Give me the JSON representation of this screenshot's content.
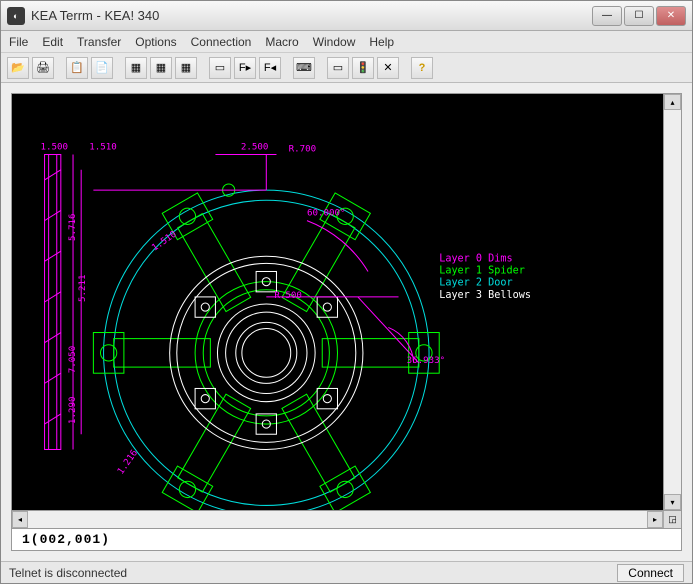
{
  "window": {
    "title": "KEA Terrm - KEA! 340"
  },
  "menu": {
    "file": "File",
    "edit": "Edit",
    "transfer": "Transfer",
    "options": "Options",
    "connection": "Connection",
    "macro": "Macro",
    "window": "Window",
    "help": "Help"
  },
  "toolbar": {
    "open": "📂",
    "print": "🖨",
    "copy": "📋",
    "paste": "📄",
    "t1": "▦",
    "t2": "▦",
    "t3": "▦",
    "t4": "▭",
    "t5": "F▸",
    "t6": "F◂",
    "t7": "⌨",
    "t8": "▭",
    "t9": "🚦",
    "t10": "✕",
    "help": "?"
  },
  "legend": {
    "l0_label": "Layer 0 Dims",
    "l1_label": "Layer 1 Spider",
    "l2_label": "Layer 2 Door",
    "l3_label": "Layer 3 Bellows",
    "l0_color": "#ff00ff",
    "l1_color": "#00ff00",
    "l2_color": "#00dddd",
    "l3_color": "#ffffff"
  },
  "dims": {
    "d1": "1.500",
    "d2": "1.510",
    "d3": "2.500",
    "d4": "R.700",
    "d5": "5.716",
    "d6": "60.000°",
    "d7": "1.510",
    "d8": "R.500",
    "d9": "5.211",
    "d10": "7.050",
    "d11": "36.933°",
    "d12": "1.290",
    "d13": "1.216"
  },
  "coords": "1(002,001)",
  "status": {
    "left": "Telnet is disconnected",
    "connect": "Connect"
  }
}
